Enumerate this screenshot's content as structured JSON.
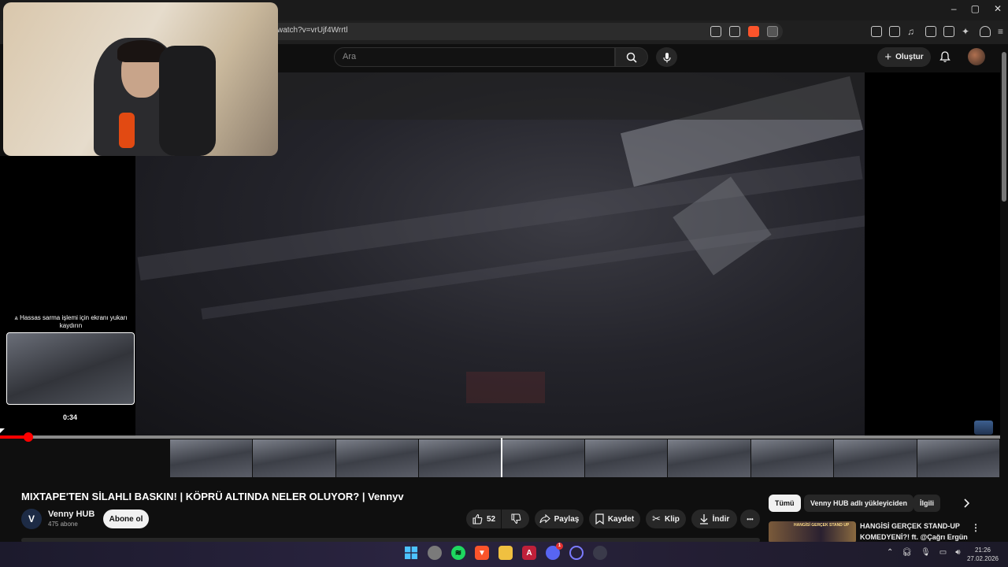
{
  "browser": {
    "url": "watch?v=vrUjf4Wrrtl",
    "window_controls": [
      "–",
      "▢",
      "✕"
    ]
  },
  "header": {
    "search_placeholder": "Ara",
    "create_label": "Oluştur"
  },
  "player": {
    "seek_hint": "⩓ Hassas sarma işlemi için ekranı yukarı kaydırın",
    "preview_time": "0:34",
    "progress_fraction": 0.028
  },
  "video": {
    "title": "MIXTAPE'TEN SİLAHLI BASKIN! | KÖPRÜ ALTINDA NELER OLUYOR? | Vennyv",
    "channel_logo_letter": "V",
    "channel_name": "Venny HUB",
    "subscribers": "475 abone",
    "subscribe_label": "Abone ol",
    "likes": "52",
    "share_label": "Paylaş",
    "save_label": "Kaydet",
    "clip_label": "Klip",
    "download_label": "İndir",
    "more_label": "•••"
  },
  "sidebar": {
    "chips": [
      "Tümü",
      "Venny HUB adlı yükleyiciden",
      "İlgili"
    ],
    "recommendation": {
      "thumb_text": "HANGİSİ GERÇEK STAND UP",
      "title_line1": "HANGİSİ GERÇEK STAND-UP",
      "title_line2": "KOMEDYENİ?! ft. @Çağrı Ergün",
      "more": "⋮"
    }
  },
  "taskbar": {
    "icons": [
      "windows-start",
      "chat",
      "spotify",
      "brave",
      "file-explorer",
      "app-a",
      "discord",
      "browser-circle",
      "steam"
    ],
    "discord_badge": "1",
    "time": "21:26",
    "date": "27.02.2026"
  },
  "colors": {
    "accent_red": "#ff0000",
    "background": "#0f0f0f",
    "surface": "#272727"
  }
}
